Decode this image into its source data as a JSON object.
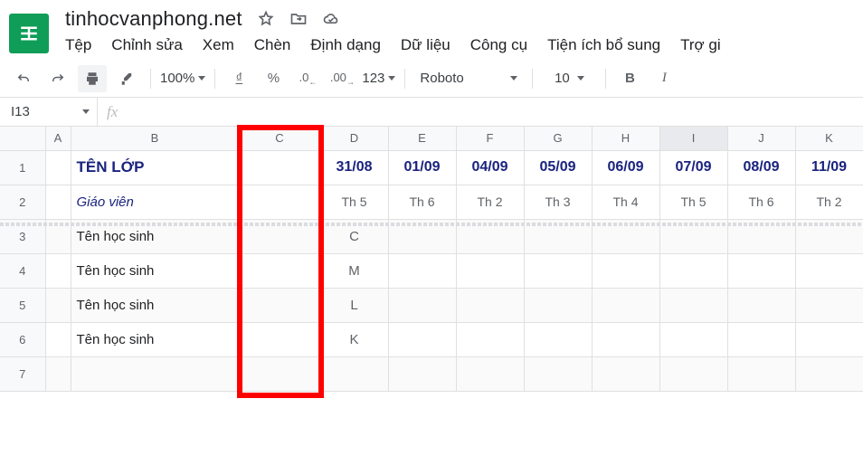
{
  "doc": {
    "title": "tinhocvanphong.net"
  },
  "menu": {
    "file": "Tệp",
    "edit": "Chỉnh sửa",
    "view": "Xem",
    "insert": "Chèn",
    "format": "Định dạng",
    "data": "Dữ liệu",
    "tools": "Công cụ",
    "addons": "Tiện ích bổ sung",
    "help": "Trợ gi"
  },
  "toolbar": {
    "zoom": "100%",
    "curr": "₫",
    "pct": "%",
    "dec0": ".0",
    "dec00": ".00",
    "num": "123",
    "font": "Roboto",
    "size": "10",
    "bold": "B",
    "italic": "I"
  },
  "namebox": {
    "ref": "I13",
    "fx": "fx"
  },
  "cols": {
    "A": "A",
    "B": "B",
    "C": "C",
    "D": "D",
    "E": "E",
    "F": "F",
    "G": "G",
    "H": "H",
    "I": "I",
    "J": "J",
    "K": "K"
  },
  "rows": {
    "r1": "1",
    "r2": "2",
    "r3": "3",
    "r4": "4",
    "r5": "5",
    "r6": "6",
    "r7": "7"
  },
  "head": {
    "class_title": "TÊN LỚP",
    "class_sub": "Giáo viên",
    "dates": [
      "31/08",
      "01/09",
      "04/09",
      "05/09",
      "06/09",
      "07/09",
      "08/09",
      "11/09"
    ],
    "days": [
      "Th 5",
      "Th 6",
      "Th 2",
      "Th 3",
      "Th 4",
      "Th 5",
      "Th 6",
      "Th 2"
    ]
  },
  "students": {
    "label": "Tên học sinh",
    "marks": [
      "C",
      "M",
      "L",
      "K"
    ]
  }
}
